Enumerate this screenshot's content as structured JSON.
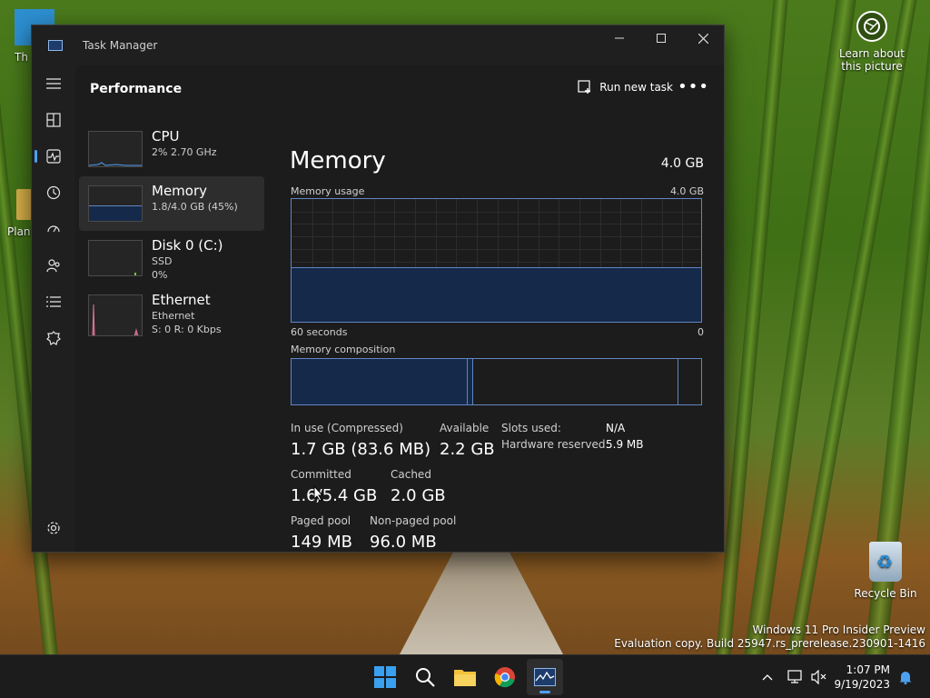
{
  "desktop": {
    "partial_icon_1": "Th",
    "partial_icon_2": "Plant",
    "learn_label": "Learn about this picture",
    "recycle_bin_label": "Recycle Bin",
    "watermark_line1": "Windows 11 Pro Insider Preview",
    "watermark_line2": "Evaluation copy. Build 25947.rs_prerelease.230901-1416"
  },
  "window": {
    "title": "Task Manager",
    "page_title": "Performance",
    "run_new_task": "Run new task"
  },
  "nav_icons": [
    "hamburger-icon",
    "processes-icon",
    "performance-icon",
    "app-history-icon",
    "startup-apps-icon",
    "users-icon",
    "details-icon",
    "services-icon",
    "settings-icon"
  ],
  "sidebar": {
    "items": [
      {
        "name": "CPU",
        "sub1": "2%  2.70 GHz",
        "sub2": "",
        "sub3": ""
      },
      {
        "name": "Memory",
        "sub1": "1.8/4.0 GB (45%)",
        "sub2": "",
        "sub3": ""
      },
      {
        "name": "Disk 0 (C:)",
        "sub1": "SSD",
        "sub2": "0%",
        "sub3": ""
      },
      {
        "name": "Ethernet",
        "sub1": "Ethernet",
        "sub2": "S: 0 R: 0 Kbps",
        "sub3": ""
      }
    ]
  },
  "memory": {
    "title": "Memory",
    "total": "4.0 GB",
    "usage_label": "Memory usage",
    "usage_max": "4.0 GB",
    "axis_left": "60 seconds",
    "axis_right": "0",
    "composition_label": "Memory composition",
    "usage_level_fraction": 0.45,
    "stats": {
      "in_use_label": "In use (Compressed)",
      "in_use_value": "1.7 GB (83.6 MB)",
      "available_label": "Available",
      "available_value": "2.2 GB",
      "committed_label": "Committed",
      "committed_value": "1.6/5.4 GB",
      "cached_label": "Cached",
      "cached_value": "2.0 GB",
      "paged_label": "Paged pool",
      "paged_value": "149 MB",
      "nonpaged_label": "Non-paged pool",
      "nonpaged_value": "96.0 MB",
      "slots_label": "Slots used:",
      "slots_value": "N/A",
      "hw_label": "Hardware reserved:",
      "hw_value": "5.9 MB"
    }
  },
  "taskbar": {
    "time": "1:07 PM",
    "date": "9/19/2023"
  },
  "colors": {
    "accent": "#4ca0f0",
    "graph_line": "#5f86c2",
    "graph_fill": "#15294a"
  }
}
